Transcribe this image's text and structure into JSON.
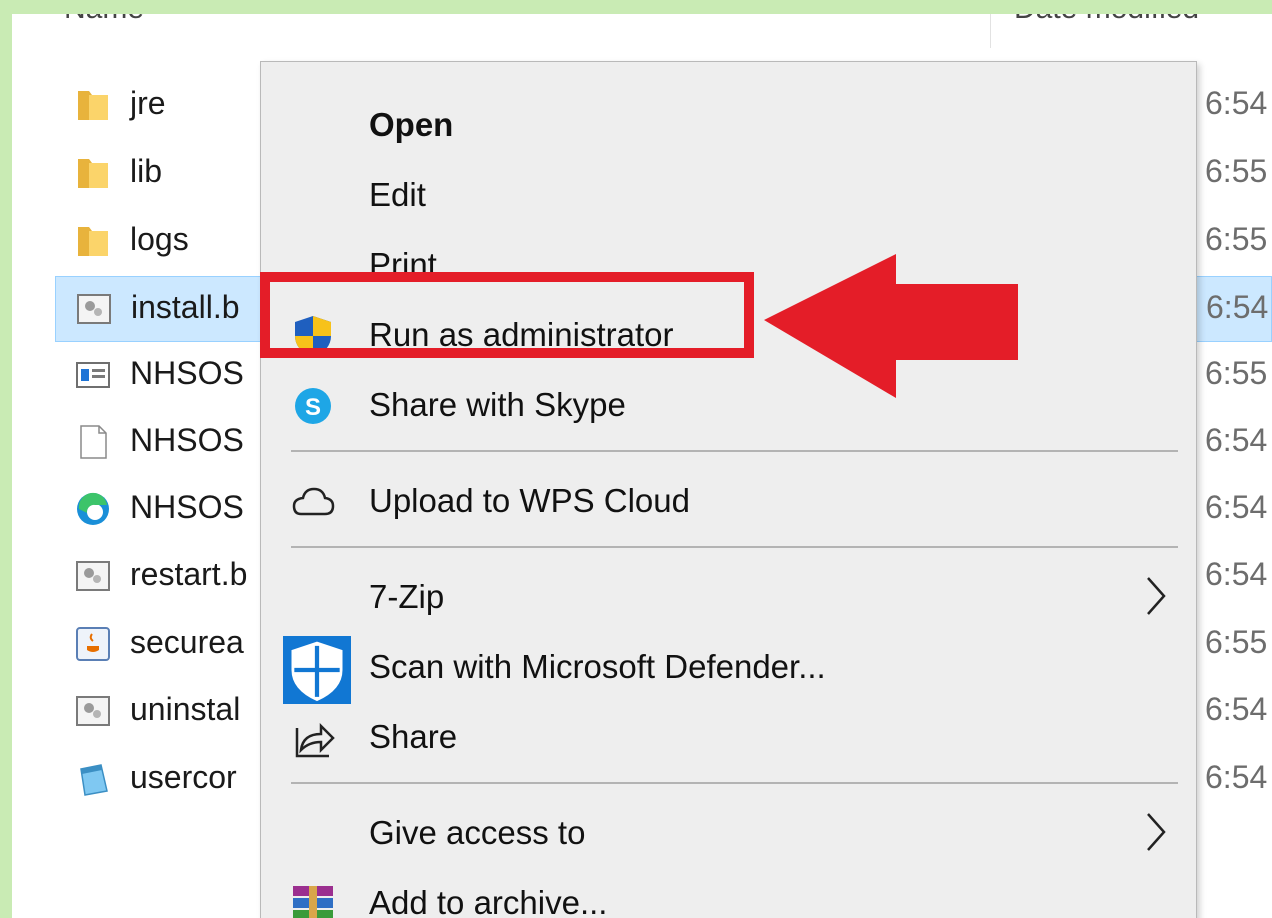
{
  "explorer": {
    "columns": {
      "name": "Name",
      "date_modified": "Date modified"
    },
    "files": [
      {
        "name": "jre",
        "date": "6:54",
        "icon": "folder-icon"
      },
      {
        "name": "lib",
        "date": "6:55",
        "icon": "folder-icon"
      },
      {
        "name": "logs",
        "date": "6:55",
        "icon": "folder-icon"
      },
      {
        "name": "install.b",
        "date": "6:54",
        "icon": "batch-file-icon",
        "selected": true
      },
      {
        "name": "NHSOS",
        "date": "6:55",
        "icon": "window-app-icon"
      },
      {
        "name": "NHSOS",
        "date": "6:54",
        "icon": "blank-document-icon"
      },
      {
        "name": "NHSOS",
        "date": "6:54",
        "icon": "edge-icon"
      },
      {
        "name": "restart.b",
        "date": "6:54",
        "icon": "batch-file-icon"
      },
      {
        "name": "securea",
        "date": "6:55",
        "icon": "java-icon"
      },
      {
        "name": "uninstal",
        "date": "6:54",
        "icon": "batch-file-icon"
      },
      {
        "name": "usercor",
        "date": "6:54",
        "icon": "notepad-icon"
      }
    ]
  },
  "context_menu": {
    "items": [
      {
        "label": "Open",
        "bold": true
      },
      {
        "label": "Edit"
      },
      {
        "label": "Print"
      },
      {
        "label": "Run as administrator",
        "icon": "uac-shield-icon"
      },
      {
        "label": "Share with Skype",
        "icon": "skype-icon"
      },
      {
        "label": "Upload to WPS Cloud",
        "icon": "cloud-icon"
      },
      {
        "label": "7-Zip",
        "submenu": true
      },
      {
        "label": "Scan with Microsoft Defender...",
        "icon": "defender-shield-icon"
      },
      {
        "label": "Share",
        "icon": "share-icon"
      },
      {
        "label": "Give access to",
        "submenu": true
      },
      {
        "label": "Add to archive...",
        "icon": "winrar-icon"
      }
    ]
  },
  "annotation": {
    "color": "#e41d28",
    "highlighted_item": "Run as administrator"
  }
}
